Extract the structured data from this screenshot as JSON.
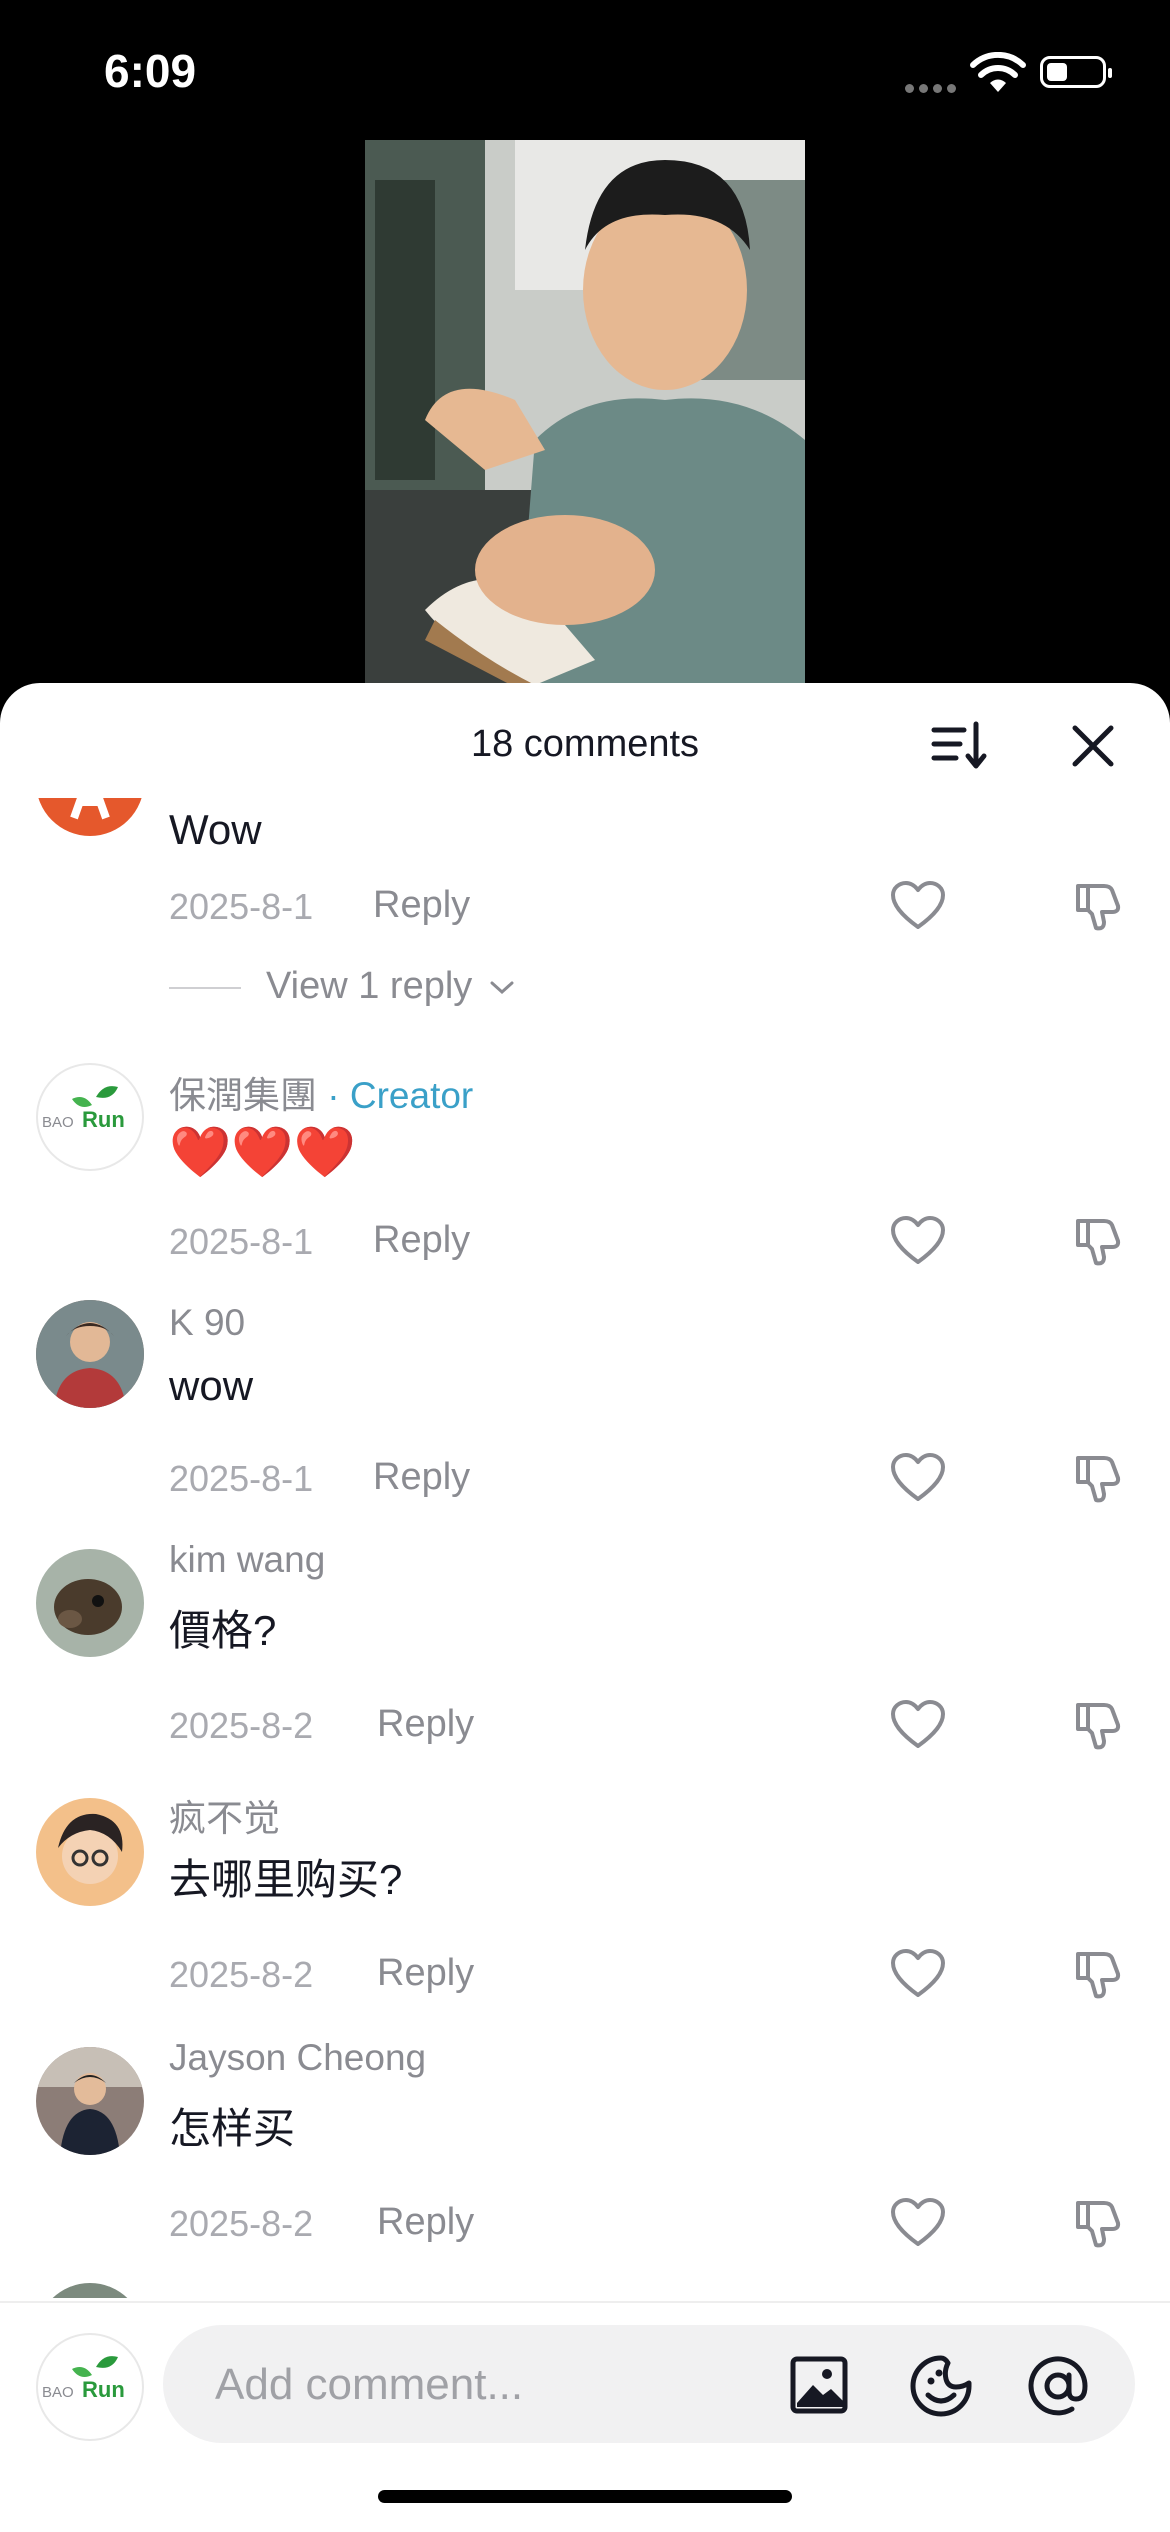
{
  "status": {
    "time": "6:09"
  },
  "sheet": {
    "title": "18 comments"
  },
  "comments": [
    {
      "username": "",
      "text": "Wow",
      "date": "2025-8-1",
      "reply_label": "Reply",
      "view_replies": "View 1 reply"
    },
    {
      "username": "保潤集團",
      "badge": "· Creator",
      "text": "❤️❤️❤️",
      "date": "2025-8-1",
      "reply_label": "Reply"
    },
    {
      "username": "K 90",
      "text": "wow",
      "date": "2025-8-1",
      "reply_label": "Reply"
    },
    {
      "username": "kim wang",
      "text": "價格?",
      "date": "2025-8-2",
      "reply_label": "Reply"
    },
    {
      "username": "疯不觉",
      "text": "去哪里购买?",
      "date": "2025-8-2",
      "reply_label": "Reply"
    },
    {
      "username": "Jayson Cheong",
      "text": "怎样买",
      "date": "2025-8-2",
      "reply_label": "Reply"
    }
  ],
  "input": {
    "placeholder": "Add comment..."
  },
  "brand": {
    "logo_text": "BAORun",
    "accent_color": "#3aa0c8",
    "like_icon": "heart-outline-icon",
    "dislike_icon": "thumbs-down-icon"
  }
}
